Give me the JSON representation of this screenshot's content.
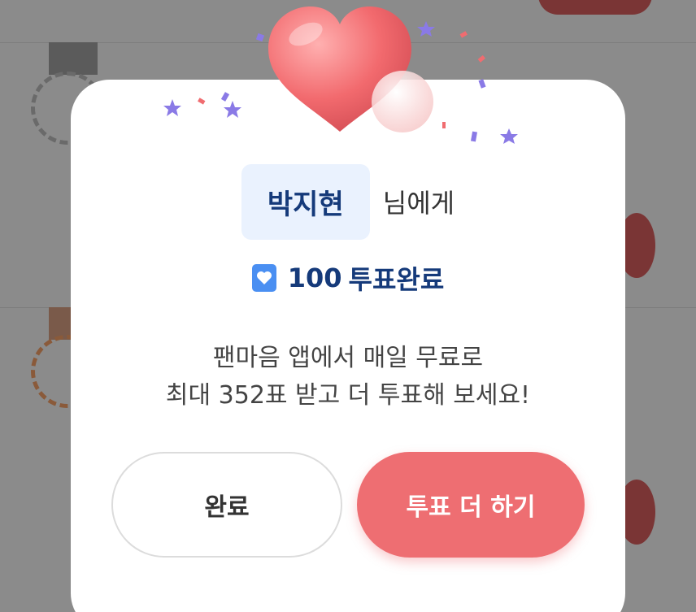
{
  "modal": {
    "recipient_name": "박지현",
    "recipient_suffix": "님에게",
    "vote_count": "100",
    "vote_status": "투표완료",
    "message_line1": "팬마음 앱에서 매일 무료로",
    "message_line2": "최대 352표 받고 더 투표해 보세요!",
    "done_label": "완료",
    "more_label": "투표 더 하기"
  },
  "colors": {
    "accent_blue": "#153a7a",
    "name_bg": "#eaf2fe",
    "vote_icon": "#4a8ff2",
    "primary_button": "#ee6e72",
    "heart": "#f06c70"
  },
  "icons": {
    "vote_icon": "heart-badge-icon",
    "decoration": "heart-icon"
  }
}
